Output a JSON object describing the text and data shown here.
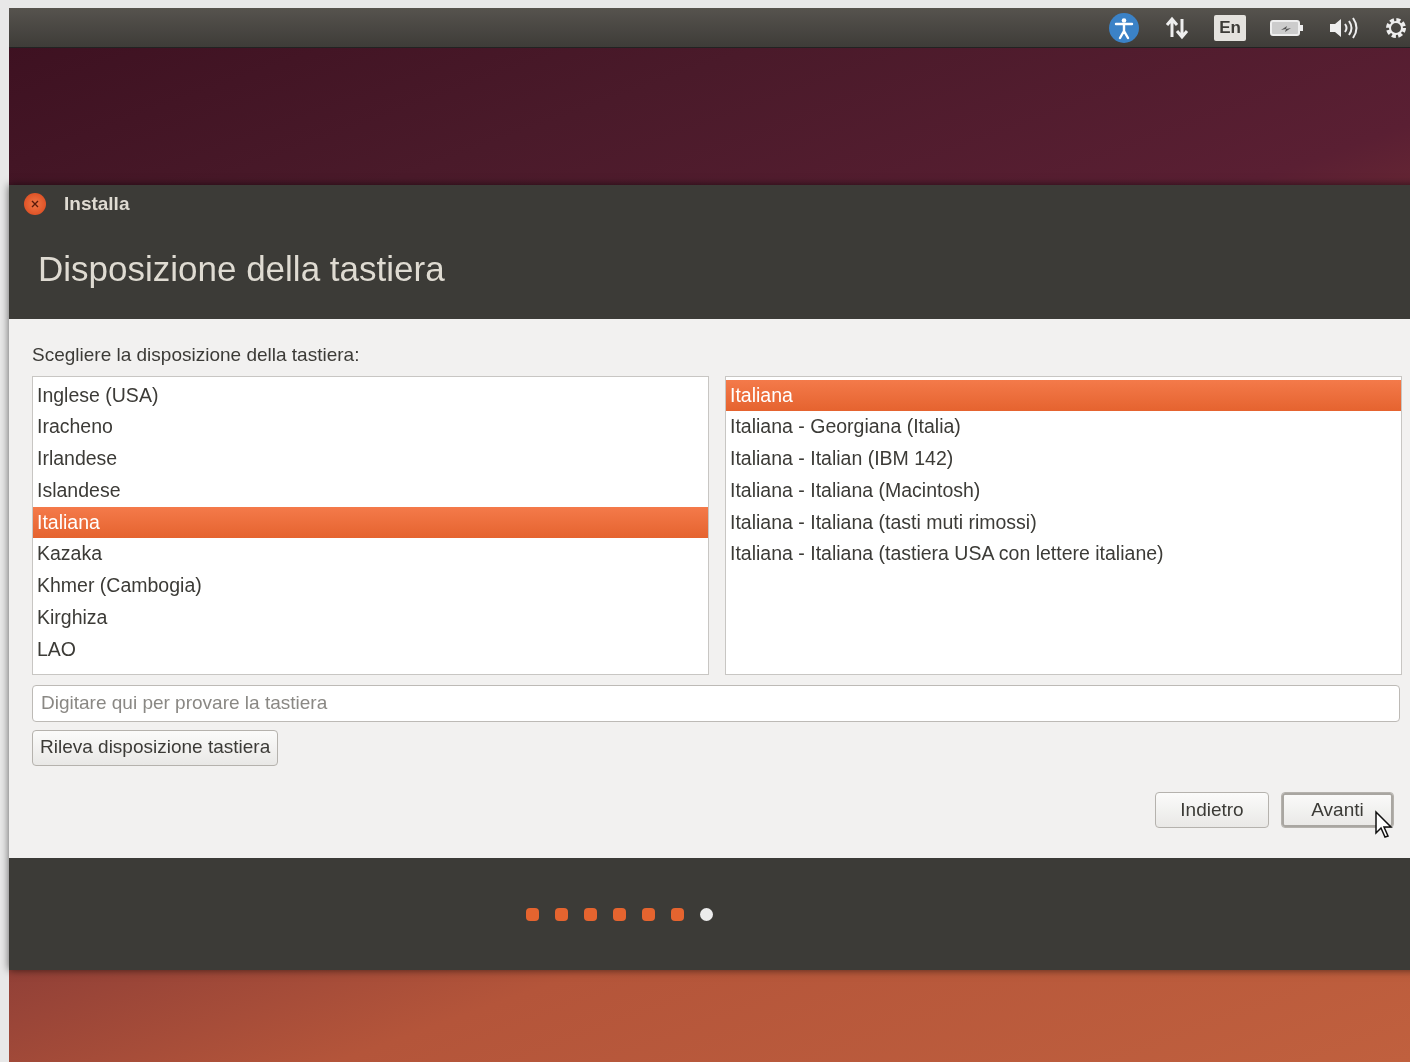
{
  "top_panel": {
    "language_indicator": "En"
  },
  "window": {
    "title": "Installa",
    "heading": "Disposizione della tastiera"
  },
  "prompt": "Scegliere la disposizione della tastiera:",
  "layouts": [
    {
      "label": "Inglese (USA)",
      "selected": false
    },
    {
      "label": "Iracheno",
      "selected": false
    },
    {
      "label": "Irlandese",
      "selected": false
    },
    {
      "label": "Islandese",
      "selected": false
    },
    {
      "label": "Italiana",
      "selected": true
    },
    {
      "label": "Kazaka",
      "selected": false
    },
    {
      "label": "Khmer (Cambogia)",
      "selected": false
    },
    {
      "label": "Kirghiza",
      "selected": false
    },
    {
      "label": "LAO",
      "selected": false
    }
  ],
  "variants": [
    {
      "label": "Italiana",
      "selected": true
    },
    {
      "label": "Italiana - Georgiana (Italia)",
      "selected": false
    },
    {
      "label": "Italiana - Italian (IBM 142)",
      "selected": false
    },
    {
      "label": "Italiana - Italiana (Macintosh)",
      "selected": false
    },
    {
      "label": "Italiana - Italiana (tasti muti rimossi)",
      "selected": false
    },
    {
      "label": "Italiana - Italiana (tastiera USA con lettere italiane)",
      "selected": false
    }
  ],
  "test_field": {
    "placeholder": "Digitare qui per provare la tastiera"
  },
  "detect_button": "Rileva disposizione tastiera",
  "buttons": [
    {
      "label": "Indietro",
      "default": false
    },
    {
      "label": "Avanti",
      "default": true
    }
  ],
  "steps": [
    {
      "selected": false
    },
    {
      "selected": false
    },
    {
      "selected": false
    },
    {
      "selected": false
    },
    {
      "selected": false
    },
    {
      "selected": false
    },
    {
      "selected": true
    }
  ]
}
